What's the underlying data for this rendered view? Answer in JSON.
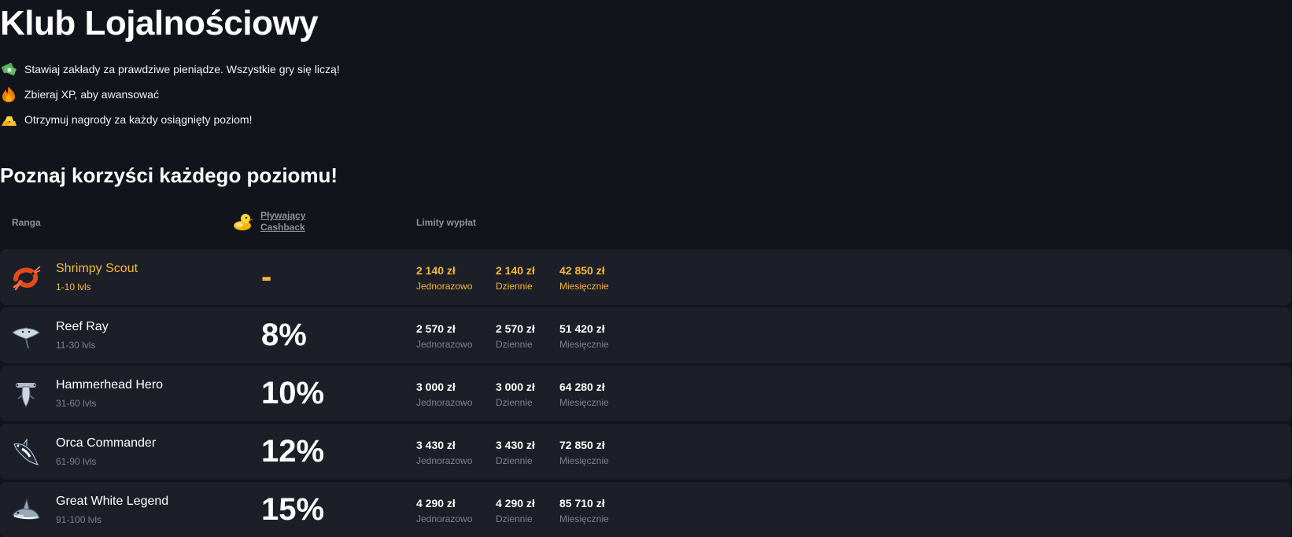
{
  "page": {
    "title": "Klub Lojalnościowy",
    "bullets": [
      {
        "icon": "money-icon",
        "text": "Stawiaj zakłady za prawdziwe pieniądze. Wszystkie gry się liczą!"
      },
      {
        "icon": "fire-icon",
        "text": "Zbieraj XP, aby awansować"
      },
      {
        "icon": "gold-bars-icon",
        "text": "Otrzymuj nagrody za każdy osiągnięty poziom!"
      }
    ],
    "section_title": "Poznaj korzyści każdego poziomu!"
  },
  "table": {
    "headers": {
      "rank": "Ranga",
      "cashback_line1": "Pływający",
      "cashback_line2": "Cashback",
      "limits": "Limity wypłat"
    },
    "accent_color": "#f5b73b",
    "rows": [
      {
        "icon": "shrimp-icon",
        "name": "Shrimpy Scout",
        "levels": "1-10 lvls",
        "cashback": "-",
        "limits": [
          {
            "amount": "2 140 zł",
            "period": "Jednorazowo"
          },
          {
            "amount": "2 140 zł",
            "period": "Dziennie"
          },
          {
            "amount": "42 850 zł",
            "period": "Miesięcznie"
          }
        ]
      },
      {
        "icon": "ray-icon",
        "name": "Reef Ray",
        "levels": "11-30 lvls",
        "cashback": "8%",
        "limits": [
          {
            "amount": "2 570 zł",
            "period": "Jednorazowo"
          },
          {
            "amount": "2 570 zł",
            "period": "Dziennie"
          },
          {
            "amount": "51 420 zł",
            "period": "Miesięcznie"
          }
        ]
      },
      {
        "icon": "hammerhead-icon",
        "name": "Hammerhead Hero",
        "levels": "31-60 lvls",
        "cashback": "10%",
        "limits": [
          {
            "amount": "3 000 zł",
            "period": "Jednorazowo"
          },
          {
            "amount": "3 000 zł",
            "period": "Dziennie"
          },
          {
            "amount": "64 280 zł",
            "period": "Miesięcznie"
          }
        ]
      },
      {
        "icon": "orca-icon",
        "name": "Orca Commander",
        "levels": "61-90 lvls",
        "cashback": "12%",
        "limits": [
          {
            "amount": "3 430 zł",
            "period": "Jednorazowo"
          },
          {
            "amount": "3 430 zł",
            "period": "Dziennie"
          },
          {
            "amount": "72 850 zł",
            "period": "Miesięcznie"
          }
        ]
      },
      {
        "icon": "great-white-shark-icon",
        "name": "Great White Legend",
        "levels": "91-100 lvls",
        "cashback": "15%",
        "limits": [
          {
            "amount": "4 290 zł",
            "period": "Jednorazowo"
          },
          {
            "amount": "4 290 zł",
            "period": "Dziennie"
          },
          {
            "amount": "85 710 zł",
            "period": "Miesięcznie"
          }
        ]
      }
    ]
  }
}
